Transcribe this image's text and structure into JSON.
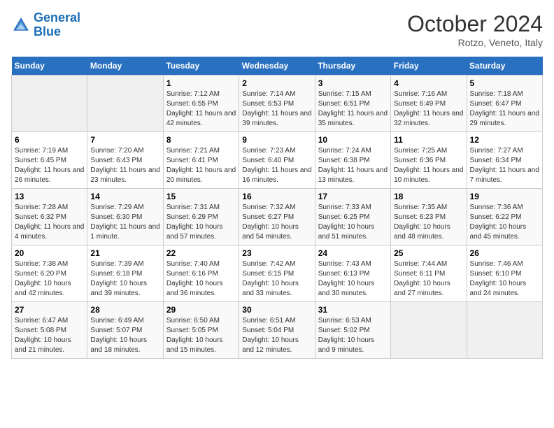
{
  "header": {
    "logo_line1": "General",
    "logo_line2": "Blue",
    "month_title": "October 2024",
    "subtitle": "Rotzo, Veneto, Italy"
  },
  "weekdays": [
    "Sunday",
    "Monday",
    "Tuesday",
    "Wednesday",
    "Thursday",
    "Friday",
    "Saturday"
  ],
  "weeks": [
    [
      {
        "day": "",
        "sunrise": "",
        "sunset": "",
        "daylight": ""
      },
      {
        "day": "",
        "sunrise": "",
        "sunset": "",
        "daylight": ""
      },
      {
        "day": "1",
        "sunrise": "Sunrise: 7:12 AM",
        "sunset": "Sunset: 6:55 PM",
        "daylight": "Daylight: 11 hours and 42 minutes."
      },
      {
        "day": "2",
        "sunrise": "Sunrise: 7:14 AM",
        "sunset": "Sunset: 6:53 PM",
        "daylight": "Daylight: 11 hours and 39 minutes."
      },
      {
        "day": "3",
        "sunrise": "Sunrise: 7:15 AM",
        "sunset": "Sunset: 6:51 PM",
        "daylight": "Daylight: 11 hours and 35 minutes."
      },
      {
        "day": "4",
        "sunrise": "Sunrise: 7:16 AM",
        "sunset": "Sunset: 6:49 PM",
        "daylight": "Daylight: 11 hours and 32 minutes."
      },
      {
        "day": "5",
        "sunrise": "Sunrise: 7:18 AM",
        "sunset": "Sunset: 6:47 PM",
        "daylight": "Daylight: 11 hours and 29 minutes."
      }
    ],
    [
      {
        "day": "6",
        "sunrise": "Sunrise: 7:19 AM",
        "sunset": "Sunset: 6:45 PM",
        "daylight": "Daylight: 11 hours and 26 minutes."
      },
      {
        "day": "7",
        "sunrise": "Sunrise: 7:20 AM",
        "sunset": "Sunset: 6:43 PM",
        "daylight": "Daylight: 11 hours and 23 minutes."
      },
      {
        "day": "8",
        "sunrise": "Sunrise: 7:21 AM",
        "sunset": "Sunset: 6:41 PM",
        "daylight": "Daylight: 11 hours and 20 minutes."
      },
      {
        "day": "9",
        "sunrise": "Sunrise: 7:23 AM",
        "sunset": "Sunset: 6:40 PM",
        "daylight": "Daylight: 11 hours and 16 minutes."
      },
      {
        "day": "10",
        "sunrise": "Sunrise: 7:24 AM",
        "sunset": "Sunset: 6:38 PM",
        "daylight": "Daylight: 11 hours and 13 minutes."
      },
      {
        "day": "11",
        "sunrise": "Sunrise: 7:25 AM",
        "sunset": "Sunset: 6:36 PM",
        "daylight": "Daylight: 11 hours and 10 minutes."
      },
      {
        "day": "12",
        "sunrise": "Sunrise: 7:27 AM",
        "sunset": "Sunset: 6:34 PM",
        "daylight": "Daylight: 11 hours and 7 minutes."
      }
    ],
    [
      {
        "day": "13",
        "sunrise": "Sunrise: 7:28 AM",
        "sunset": "Sunset: 6:32 PM",
        "daylight": "Daylight: 11 hours and 4 minutes."
      },
      {
        "day": "14",
        "sunrise": "Sunrise: 7:29 AM",
        "sunset": "Sunset: 6:30 PM",
        "daylight": "Daylight: 11 hours and 1 minute."
      },
      {
        "day": "15",
        "sunrise": "Sunrise: 7:31 AM",
        "sunset": "Sunset: 6:29 PM",
        "daylight": "Daylight: 10 hours and 57 minutes."
      },
      {
        "day": "16",
        "sunrise": "Sunrise: 7:32 AM",
        "sunset": "Sunset: 6:27 PM",
        "daylight": "Daylight: 10 hours and 54 minutes."
      },
      {
        "day": "17",
        "sunrise": "Sunrise: 7:33 AM",
        "sunset": "Sunset: 6:25 PM",
        "daylight": "Daylight: 10 hours and 51 minutes."
      },
      {
        "day": "18",
        "sunrise": "Sunrise: 7:35 AM",
        "sunset": "Sunset: 6:23 PM",
        "daylight": "Daylight: 10 hours and 48 minutes."
      },
      {
        "day": "19",
        "sunrise": "Sunrise: 7:36 AM",
        "sunset": "Sunset: 6:22 PM",
        "daylight": "Daylight: 10 hours and 45 minutes."
      }
    ],
    [
      {
        "day": "20",
        "sunrise": "Sunrise: 7:38 AM",
        "sunset": "Sunset: 6:20 PM",
        "daylight": "Daylight: 10 hours and 42 minutes."
      },
      {
        "day": "21",
        "sunrise": "Sunrise: 7:39 AM",
        "sunset": "Sunset: 6:18 PM",
        "daylight": "Daylight: 10 hours and 39 minutes."
      },
      {
        "day": "22",
        "sunrise": "Sunrise: 7:40 AM",
        "sunset": "Sunset: 6:16 PM",
        "daylight": "Daylight: 10 hours and 36 minutes."
      },
      {
        "day": "23",
        "sunrise": "Sunrise: 7:42 AM",
        "sunset": "Sunset: 6:15 PM",
        "daylight": "Daylight: 10 hours and 33 minutes."
      },
      {
        "day": "24",
        "sunrise": "Sunrise: 7:43 AM",
        "sunset": "Sunset: 6:13 PM",
        "daylight": "Daylight: 10 hours and 30 minutes."
      },
      {
        "day": "25",
        "sunrise": "Sunrise: 7:44 AM",
        "sunset": "Sunset: 6:11 PM",
        "daylight": "Daylight: 10 hours and 27 minutes."
      },
      {
        "day": "26",
        "sunrise": "Sunrise: 7:46 AM",
        "sunset": "Sunset: 6:10 PM",
        "daylight": "Daylight: 10 hours and 24 minutes."
      }
    ],
    [
      {
        "day": "27",
        "sunrise": "Sunrise: 6:47 AM",
        "sunset": "Sunset: 5:08 PM",
        "daylight": "Daylight: 10 hours and 21 minutes."
      },
      {
        "day": "28",
        "sunrise": "Sunrise: 6:49 AM",
        "sunset": "Sunset: 5:07 PM",
        "daylight": "Daylight: 10 hours and 18 minutes."
      },
      {
        "day": "29",
        "sunrise": "Sunrise: 6:50 AM",
        "sunset": "Sunset: 5:05 PM",
        "daylight": "Daylight: 10 hours and 15 minutes."
      },
      {
        "day": "30",
        "sunrise": "Sunrise: 6:51 AM",
        "sunset": "Sunset: 5:04 PM",
        "daylight": "Daylight: 10 hours and 12 minutes."
      },
      {
        "day": "31",
        "sunrise": "Sunrise: 6:53 AM",
        "sunset": "Sunset: 5:02 PM",
        "daylight": "Daylight: 10 hours and 9 minutes."
      },
      {
        "day": "",
        "sunrise": "",
        "sunset": "",
        "daylight": ""
      },
      {
        "day": "",
        "sunrise": "",
        "sunset": "",
        "daylight": ""
      }
    ]
  ]
}
